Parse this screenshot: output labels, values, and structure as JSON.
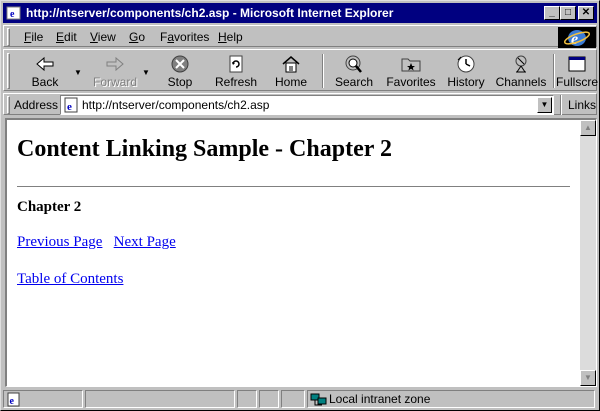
{
  "window": {
    "title": "http://ntserver/components/ch2.asp - Microsoft Internet Explorer"
  },
  "menu": [
    {
      "label": "File",
      "key": "F"
    },
    {
      "label": "Edit",
      "key": "E"
    },
    {
      "label": "View",
      "key": "V"
    },
    {
      "label": "Go",
      "key": "G"
    },
    {
      "label": "Favorites",
      "key": "a"
    },
    {
      "label": "Help",
      "key": "H"
    }
  ],
  "toolbar": {
    "back": "Back",
    "forward": "Forward",
    "stop": "Stop",
    "refresh": "Refresh",
    "home": "Home",
    "search": "Search",
    "favorites": "Favorites",
    "history": "History",
    "channels": "Channels",
    "fullscreen": "Fullscre"
  },
  "address": {
    "label": "Address",
    "value": "http://ntserver/components/ch2.asp",
    "links_label": "Links"
  },
  "page": {
    "heading": "Content Linking Sample - Chapter 2",
    "subheading": "Chapter 2",
    "prev_link": "Previous Page",
    "next_link": "Next Page",
    "toc_link": "Table of Contents"
  },
  "status": {
    "zone": "Local intranet zone"
  },
  "colors": {
    "titlebar": "#000080",
    "link": "#0000ee",
    "chrome": "#c0c0c0"
  }
}
